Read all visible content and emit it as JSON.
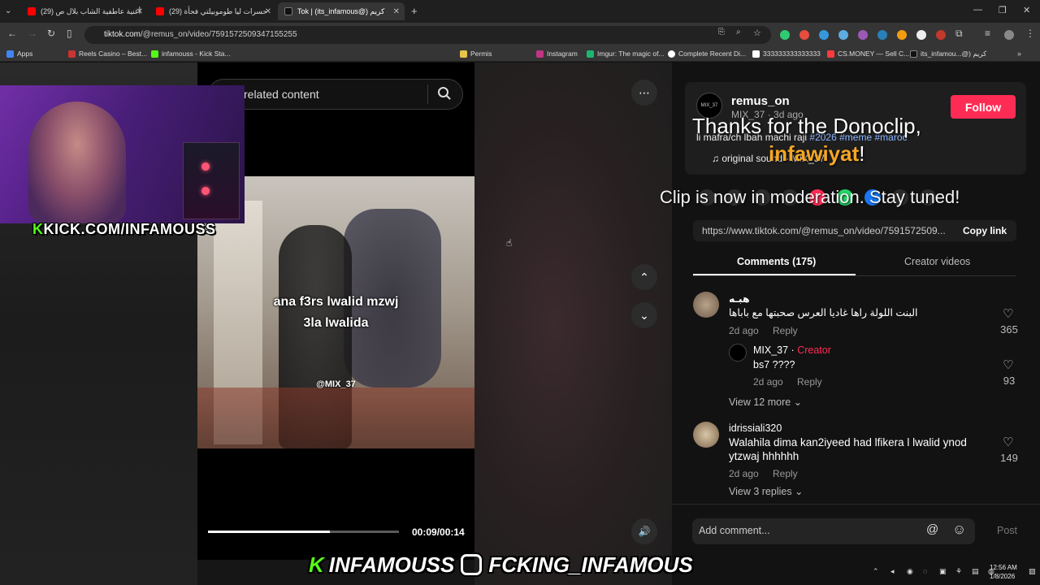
{
  "browser": {
    "tabs": [
      {
        "label": "(29) أغنية عاطفية الشاب بلال ص",
        "fav_color": "#ff0000"
      },
      {
        "label": "(29) حسرات ليا طوموبيلتي فحأة",
        "fav_color": "#ff0000"
      },
      {
        "label": "Tok | (its_infamous@) كريم",
        "fav_color": "#111111"
      }
    ],
    "new_tab": "+",
    "url_host": "tiktok.com",
    "url_path": "/@remus_on/video/7591572509347155255",
    "bookmarks": [
      {
        "label": "Apps",
        "color": "#4285f4"
      },
      {
        "label": "Reels Casino – Best...",
        "color": "#cc3333"
      },
      {
        "label": "infamouss - Kick Sta...",
        "color": "#53fc18"
      },
      {
        "label": "Permis",
        "color": "#e8c34a"
      },
      {
        "label": "Instagram",
        "color": "#c13584"
      },
      {
        "label": "Imgur: The magic of...",
        "color": "#1bb76e"
      },
      {
        "label": "Complete Recent Di...",
        "color": "#ffffff"
      },
      {
        "label": "333333333333333",
        "color": "#ffffff"
      },
      {
        "label": "CS.MONEY — Sell C...",
        "color": "#ff3b3b"
      },
      {
        "label": "its_infamou...@) كريم",
        "color": "#111111"
      }
    ]
  },
  "video": {
    "search_placeholder": "related content",
    "caption_line1": "ana f3rs lwalid mzwj",
    "caption_line2": "3la lwalida",
    "watermark": "@MIX_37",
    "timecode": "00:09/00:14",
    "progress": 0.64,
    "more_icon": "⋯",
    "up_icon": "⌃",
    "down_icon": "⌄",
    "volume_icon": "🔊"
  },
  "webcam": {
    "label": "KICK.COM/INFAMOUSS",
    "k": "K"
  },
  "post": {
    "avatar_text": "MIX_37",
    "username": "remus_on",
    "meta": "MIX_37 · 3d ago",
    "follow_label": "Follow",
    "description": "li mafra/ch lbah machi raji",
    "hashtags": [
      "#2026",
      "#meme",
      "#maroc"
    ],
    "sound": "♫  original sound - MIX_37",
    "link_url": "https://www.tiktok.com/@remus_on/video/7591572509...",
    "copy_link_label": "Copy link"
  },
  "overlay": {
    "donoclip_line1": "Thanks for the Donoclip,",
    "donoclip_name": "infawiyat",
    "donoclip_bang": "!",
    "moderation": "Clip is now in moderation. Stay tuned!"
  },
  "comments_tabs": {
    "comments": "Comments (175)",
    "creator": "Creator videos"
  },
  "comments": [
    {
      "name": "هبـه",
      "text": "البنت اللولة راها غاديا العرس صحبتها مع باباها",
      "time": "2d ago",
      "reply": "Reply",
      "likes": "365"
    },
    {
      "name": "MIX_37 · ",
      "creator": "Creator",
      "text": "bs7 ????",
      "time": "2d ago",
      "reply": "Reply",
      "likes": "93"
    },
    {
      "name": "idrissiali320",
      "text_line1": "Walahila dima kan2iyeed had lfikera l lwalid ynod",
      "text_line2": "ytzwaj hhhhhh",
      "time": "2d ago",
      "reply": "Reply",
      "likes": "149"
    }
  ],
  "view_more_1": "View 12 more ⌄",
  "view_more_2": "View 3 replies ⌄",
  "add_comment": "Add comment...",
  "post_label": "Post",
  "at_icon": "@",
  "emoji_icon": "☺",
  "social": {
    "k": "K",
    "kick_name": "INFAMOUSS",
    "ig_name": "FCKING_INFAMOUS"
  },
  "tray": {
    "time": "12:56 AM",
    "date": "1/8/2026"
  }
}
